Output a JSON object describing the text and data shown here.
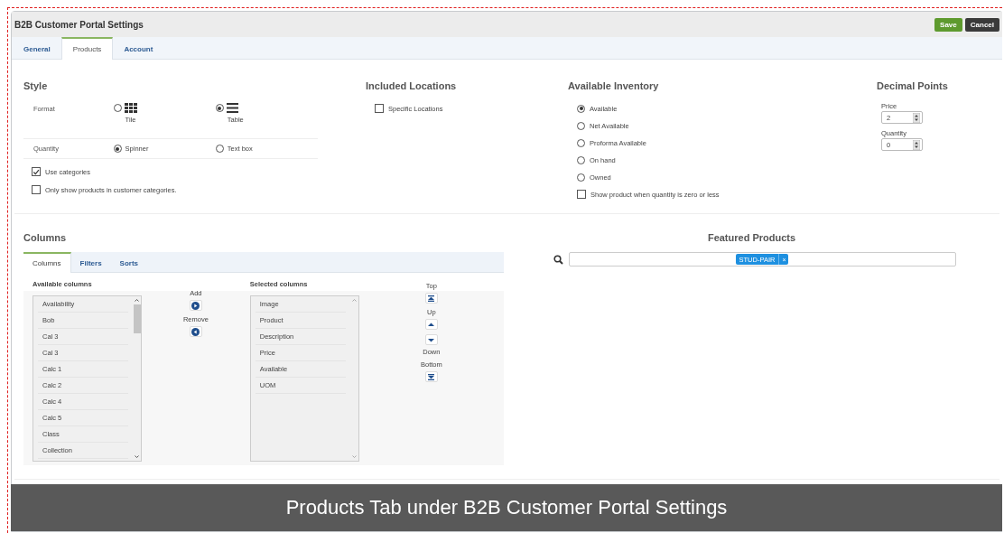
{
  "window": {
    "title": "B2B Customer Portal Settings"
  },
  "buttons": [
    {
      "label": "Save",
      "kind": "primary"
    },
    {
      "label": "Cancel",
      "kind": "dark"
    }
  ],
  "tabs": [
    {
      "label": "General",
      "selected": false
    },
    {
      "label": "Products",
      "selected": true
    },
    {
      "label": "Account",
      "selected": false
    }
  ],
  "style": {
    "title": "Style",
    "format": {
      "label": "Format",
      "options": [
        {
          "label": "Tile",
          "kind": "tile",
          "selected": false
        },
        {
          "label": "Table",
          "kind": "table",
          "selected": true
        }
      ]
    },
    "quantity": {
      "label": "Quantity",
      "options": [
        {
          "label": "Spinner",
          "selected": true
        },
        {
          "label": "Text box",
          "selected": false
        }
      ]
    },
    "checkboxes": [
      {
        "label": "Use categories",
        "checked": true
      },
      {
        "label": "Only show products in customer categories.",
        "checked": false
      }
    ]
  },
  "included_locations": {
    "title": "Included Locations",
    "checkboxes": [
      {
        "label": "Specific Locations",
        "checked": false
      }
    ]
  },
  "available_inventory": {
    "title": "Available Inventory",
    "options": [
      {
        "label": "Available",
        "selected": true
      },
      {
        "label": "Net Available",
        "selected": false
      },
      {
        "label": "Proforma Available",
        "selected": false
      },
      {
        "label": "On hand",
        "selected": false
      },
      {
        "label": "Owned",
        "selected": false
      }
    ],
    "checkboxes": [
      {
        "label": "Show product when quantity is zero or less",
        "checked": false
      }
    ]
  },
  "decimal_points": {
    "title": "Decimal Points",
    "fields": [
      {
        "label": "Price",
        "value": "2"
      },
      {
        "label": "Quantity",
        "value": "0"
      }
    ]
  },
  "columns": {
    "title": "Columns",
    "tabs": [
      {
        "label": "Columns",
        "selected": true
      },
      {
        "label": "Filters",
        "selected": false
      },
      {
        "label": "Sorts",
        "selected": false
      }
    ],
    "available": {
      "title": "Available columns",
      "items": [
        "Availability",
        "Bob",
        "Cal 3",
        "Cal 3",
        "Calc 1",
        "Calc 2",
        "Calc 4",
        "Calc 5",
        "Class",
        "Collection"
      ]
    },
    "transfer": [
      {
        "label": "Add",
        "kind": "add"
      },
      {
        "label": "Remove",
        "kind": "remove"
      }
    ],
    "selected": {
      "title": "Selected columns",
      "items": [
        "Image",
        "Product",
        "Description",
        "Price",
        "Available",
        "UOM"
      ]
    },
    "move": [
      {
        "label": "Top",
        "kind": "top"
      },
      {
        "label": "Up",
        "kind": "up"
      },
      {
        "label": "Down",
        "kind": "down"
      },
      {
        "label": "Bottom",
        "kind": "bottom"
      }
    ]
  },
  "featured_products": {
    "title": "Featured Products",
    "tags": [
      {
        "label": "STUD-PAIR",
        "remove": "×"
      }
    ]
  },
  "caption": "Products Tab under B2B Customer Portal Settings"
}
